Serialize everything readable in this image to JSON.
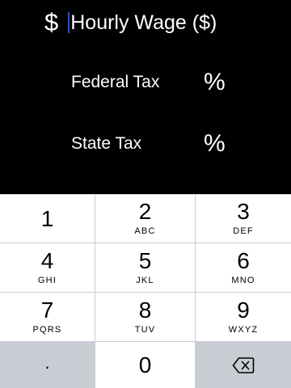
{
  "form": {
    "currency_symbol": "$",
    "wage_placeholder": "Hourly Wage ($)",
    "federal_label": "Federal Tax",
    "state_label": "State Tax",
    "percent_symbol": "%"
  },
  "keypad": {
    "keys": [
      {
        "digit": "1",
        "letters": ""
      },
      {
        "digit": "2",
        "letters": "ABC"
      },
      {
        "digit": "3",
        "letters": "DEF"
      },
      {
        "digit": "4",
        "letters": "GHI"
      },
      {
        "digit": "5",
        "letters": "JKL"
      },
      {
        "digit": "6",
        "letters": "MNO"
      },
      {
        "digit": "7",
        "letters": "PQRS"
      },
      {
        "digit": "8",
        "letters": "TUV"
      },
      {
        "digit": "9",
        "letters": "WXYZ"
      }
    ],
    "decimal": ".",
    "zero": "0",
    "backspace_icon": "backspace-icon"
  },
  "colors": {
    "background": "#000000",
    "caret": "#2a4bd8",
    "key": "#ffffff",
    "key_gray": "#c9ccd2"
  }
}
